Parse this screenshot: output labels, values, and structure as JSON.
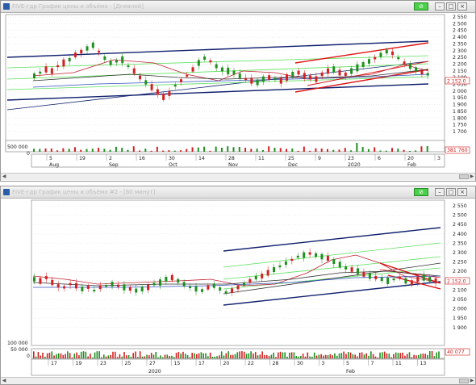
{
  "windows": [
    {
      "title": "FIVE-гдр График цены и объёма - [Дневной]",
      "price_axis": [
        "2 550",
        "2 500",
        "2 450",
        "2 400",
        "2 350",
        "2 300",
        "2 250",
        "2 200",
        "2 150",
        "2 100",
        "2 050",
        "2 000",
        "1 950",
        "1 900",
        "1 850",
        "1 800",
        "1 750",
        "1 700"
      ],
      "price_marker": "2 152.0",
      "volume_axis": [
        "500 000",
        "0"
      ],
      "volume_marker": "381 760",
      "date_ticks": [
        "5",
        "19",
        "2",
        "16",
        "30",
        "14",
        "28",
        "11",
        "25",
        "9",
        "23",
        "6",
        "20",
        "3"
      ],
      "month_labels": [
        "Aug",
        "Sep",
        "Oct",
        "Nov",
        "Dec",
        "2020",
        "Feb"
      ]
    },
    {
      "title": "FIVE-гдр График цены и объёма #2 - [60 минут]",
      "price_axis": [
        "2 550",
        "2 500",
        "2 450",
        "2 400",
        "2 350",
        "2 300",
        "2 250",
        "2 200",
        "2 150",
        "2 100",
        "2 050",
        "2 000",
        "1 950",
        "1 900"
      ],
      "price_marker": "2 152.0",
      "volume_axis": [
        "100 000",
        "50 000",
        "0"
      ],
      "volume_marker": "40 077",
      "date_ticks": [
        "17",
        "19",
        "23",
        "25",
        "27",
        "15",
        "17",
        "20",
        "22",
        "28",
        "30",
        "3",
        "5",
        "7",
        "11",
        "13"
      ],
      "month_labels": [
        "2020",
        "Feb"
      ]
    }
  ],
  "icons": {
    "window_icon": "chart-window-icon",
    "link_button": "link-icon",
    "minimize": "minimize-icon",
    "maximize": "maximize-icon",
    "close": "close-icon"
  },
  "colors": {
    "up_candle": "#1f8f1f",
    "down_candle": "#d42020",
    "trend_red": "#e01010",
    "trend_navy": "#10206e",
    "channel_green": "#5ee05e",
    "ma_red": "#c02030",
    "ma_black": "#303030",
    "ma_blue": "#3050c0",
    "marker_red": "#d01818"
  }
}
